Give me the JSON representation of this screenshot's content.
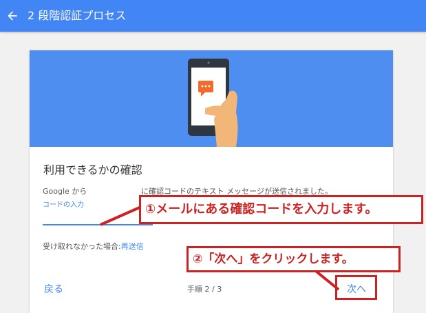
{
  "header": {
    "title": "2 段階認証プロセス"
  },
  "card": {
    "title": "利用できるかの確認",
    "source_label": "Google から",
    "code_placeholder": "コードの入力",
    "sent_message": "に確認コードのテキスト メッセージが送信されました。",
    "resend_prompt": "受け取れなかった場合:",
    "resend_link": "再送信",
    "back_button": "戻る",
    "step_text": "手順 2 / 3",
    "next_button": "次へ"
  },
  "annotations": {
    "callout1": "①メールにある確認コードを入力します。",
    "callout2": "②「次へ」をクリックします。",
    "color": "#cc2222"
  },
  "colors": {
    "accent": "#4285f4",
    "hero": "#4d8ef0"
  },
  "icons": {
    "back": "arrow-left-icon",
    "phone": "phone-chat-illustration"
  }
}
